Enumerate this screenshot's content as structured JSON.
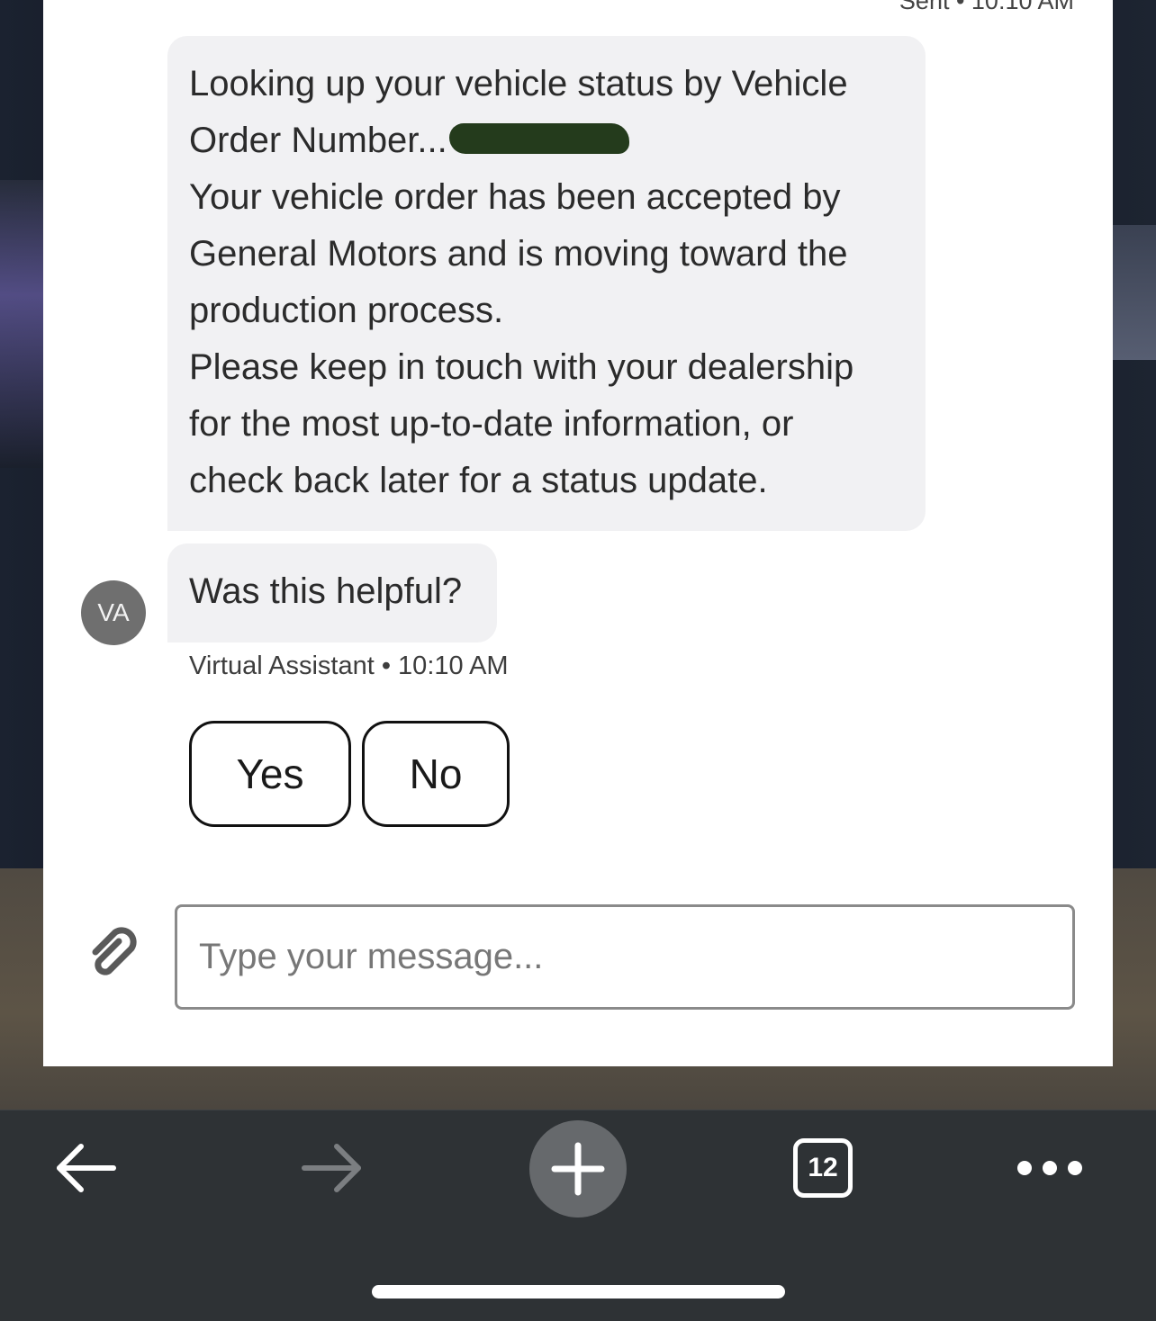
{
  "chat": {
    "sent_meta": "Sent • 10:10 AM",
    "status_message": {
      "lines": [
        "Looking up your vehicle status by Vehicle",
        "Order Number...",
        "Your vehicle order has been accepted by",
        "General Motors and is moving toward the",
        "production process.",
        "Please keep in touch with your dealership",
        "for the most up-to-date information, or",
        "check back later for a status update."
      ]
    },
    "question": "Was this helpful?",
    "avatar_initials": "VA",
    "assistant_meta": "Virtual Assistant • 10:10 AM",
    "quick_replies": {
      "yes": "Yes",
      "no": "No"
    },
    "input_placeholder": "Type your message..."
  },
  "browser_toolbar": {
    "tab_count": "12",
    "icons": [
      "back-arrow-icon",
      "forward-arrow-icon",
      "plus-icon",
      "tab-switcher-icon",
      "more-options-icon"
    ]
  },
  "colors": {
    "bubble": "#f1f1f3",
    "toolbar": "#2e3235",
    "avatar": "#6f6f6f",
    "redaction": "#243b1c"
  }
}
